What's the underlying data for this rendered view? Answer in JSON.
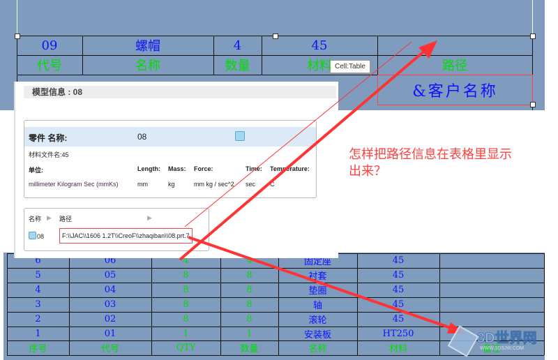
{
  "top_table": {
    "row1": [
      "09",
      "螺帽",
      "4",
      "45",
      ""
    ],
    "row2": [
      "代号",
      "名称",
      "数量",
      "材料",
      "路径"
    ],
    "selected_cell": "&客户名称"
  },
  "tooltip": "Cell:Table",
  "dialog": {
    "title": "模型信息 : 08",
    "part_label": "零件 名称:",
    "part_value": "08",
    "material": "材料文件名:45",
    "units_label": "单位:",
    "unit_headers": [
      "Length:",
      "Mass:",
      "Force:",
      "Time:",
      "Temperature:"
    ],
    "unit_system": "millimeter Kilogram Sec (mmKs)",
    "unit_values": [
      "mm",
      "kg",
      "mm kg / sec^2",
      "sec",
      "C"
    ],
    "list_headers": [
      "名称",
      "路径"
    ],
    "list_row": {
      "name": "08",
      "path": "F:\\\\JAC\\\\1606 1.2T\\\\CreoF\\\\zhaqiban\\\\08.prt.7"
    }
  },
  "question": [
    "怎样把路径信息在表格里显示",
    "出来？"
  ],
  "bom": {
    "rows": [
      [
        "6",
        "06",
        "4",
        "4",
        "固定座",
        "45",
        ""
      ],
      [
        "5",
        "05",
        "8",
        "8",
        "衬套",
        "45",
        ""
      ],
      [
        "4",
        "04",
        "8",
        "8",
        "垫圈",
        "45",
        ""
      ],
      [
        "3",
        "03",
        "8",
        "8",
        "轴",
        "45",
        ""
      ],
      [
        "2",
        "02",
        "8",
        "8",
        "滚轮",
        "45",
        ""
      ],
      [
        "1",
        "01",
        "1",
        "1",
        "安装板",
        "HT250",
        ""
      ]
    ],
    "header": [
      "序号",
      "代号",
      "QTY",
      "数量",
      "名称",
      "材料",
      "备注"
    ]
  },
  "watermark": {
    "name": "3D世界网",
    "url": "WWW.3DSJW.COM"
  },
  "colors": {
    "canvas": "#7f9cbf",
    "value": "#1010ff",
    "header": "#00dd00",
    "annotation": "#ff3333"
  }
}
